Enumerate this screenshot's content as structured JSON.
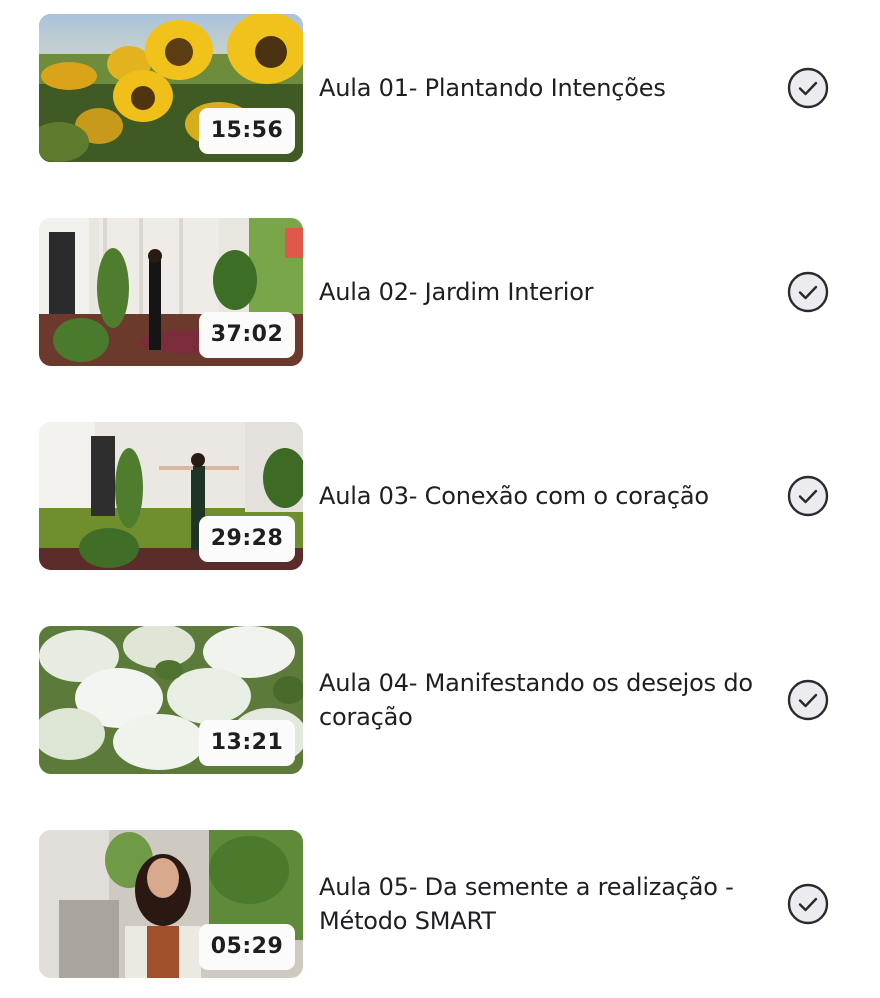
{
  "lessons": [
    {
      "title": "Aula 01- Plantando Intenções",
      "duration": "15:56",
      "thumbnail": "sunflower-field",
      "completed": true
    },
    {
      "title": "Aula 02- Jardim Interior",
      "duration": "37:02",
      "thumbnail": "woman-standing-in-green-room",
      "completed": true
    },
    {
      "title": "Aula 03- Conexão com o coração",
      "duration": "29:28",
      "thumbnail": "woman-arms-open-in-green-room",
      "completed": true
    },
    {
      "title": "Aula 04- Manifestando os desejos do coração",
      "duration": "13:21",
      "thumbnail": "white-lilac-flowers",
      "completed": true
    },
    {
      "title": "Aula 05- Da semente a realização - Método SMART",
      "duration": "05:29",
      "thumbnail": "woman-speaking-to-camera",
      "completed": true
    }
  ],
  "icons": {
    "completed": "check-circle-icon"
  },
  "colors": {
    "text": "#1f1f23",
    "badge_bg": "#fbfbfb",
    "check_fill": "#ececf0",
    "check_stroke": "#2a2a2e"
  }
}
